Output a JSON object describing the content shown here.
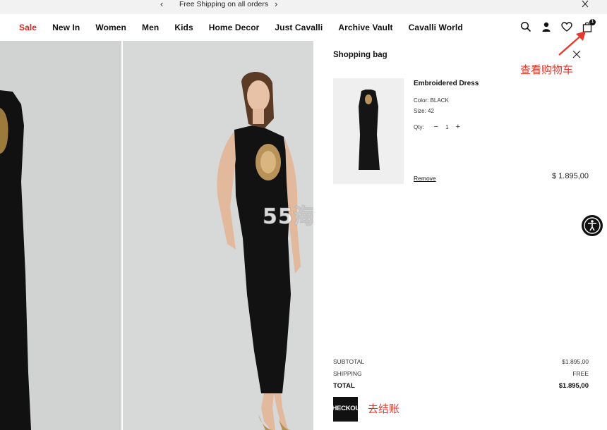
{
  "announcement": {
    "message": "Free Shipping on all orders",
    "prev_arrow": "‹",
    "next_arrow": "›"
  },
  "nav": {
    "items": [
      {
        "label": "Sale",
        "sale": true
      },
      {
        "label": "New In"
      },
      {
        "label": "Women"
      },
      {
        "label": "Men"
      },
      {
        "label": "Kids"
      },
      {
        "label": "Home Decor"
      },
      {
        "label": "Just Cavalli"
      },
      {
        "label": "Archive Vault"
      },
      {
        "label": "Cavalli World"
      }
    ],
    "cart_count": "1"
  },
  "bag": {
    "title": "Shopping bag",
    "item": {
      "name": "Embroidered Dress",
      "color": "Color: BLACK",
      "size": "Size: 42",
      "qty_label": "Qty:",
      "qty_minus": "−",
      "qty": "1",
      "qty_plus": "+",
      "remove": "Remove",
      "price": "$ 1.895,00"
    },
    "subtotal_label": "SUBTOTAL",
    "subtotal_value": "$1.895,00",
    "shipping_label": "SHIPPING",
    "shipping_value": "FREE",
    "total_label": "TOTAL",
    "total_value": "$1.895,00",
    "checkout_label": "CHECKOUT"
  },
  "annotations": {
    "cart_note": "查看购物车",
    "checkout_note": "去结账"
  },
  "watermark": "55海淘",
  "colors": {
    "sale": "#dd2222",
    "annotation": "#e53a2d",
    "dark": "#111111"
  }
}
